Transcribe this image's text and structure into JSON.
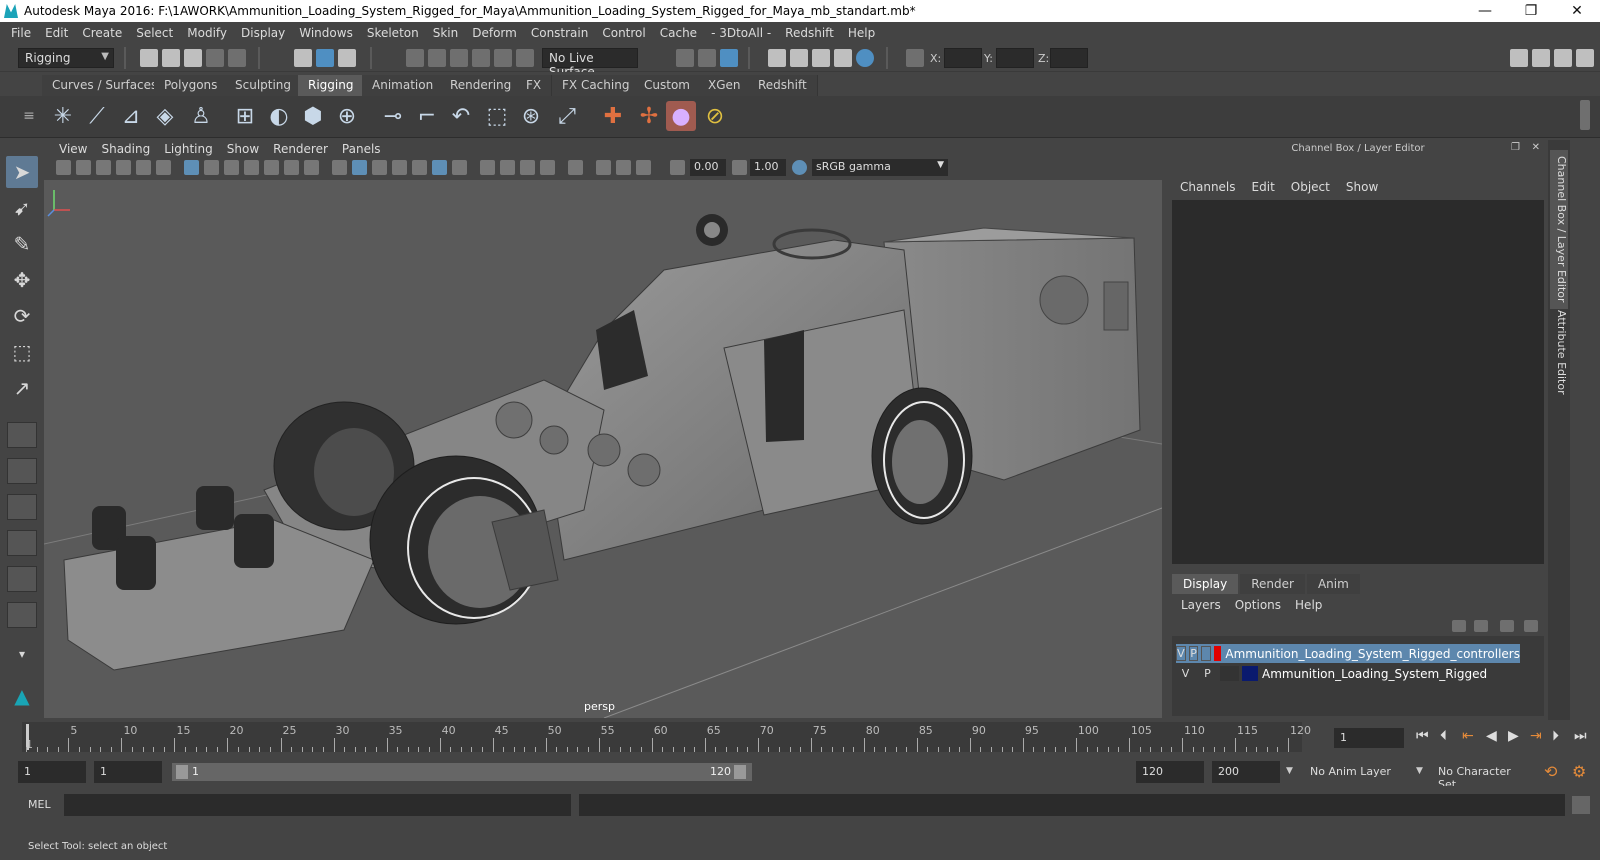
{
  "window": {
    "title": "Autodesk Maya 2016: F:\\1AWORK\\Ammunition_Loading_System_Rigged_for_Maya\\Ammunition_Loading_System_Rigged_for_Maya_mb_standart.mb*",
    "minimize": "—",
    "maximize": "❐",
    "close": "✕"
  },
  "menubar": [
    "File",
    "Edit",
    "Create",
    "Select",
    "Modify",
    "Display",
    "Windows",
    "Skeleton",
    "Skin",
    "Deform",
    "Constrain",
    "Control",
    "Cache",
    "- 3DtoAll -",
    "Redshift",
    "Help"
  ],
  "statusline": {
    "menuset": "Rigging",
    "live_surface": "No Live Surface",
    "x_label": "X:",
    "y_label": "Y:",
    "z_label": "Z:"
  },
  "shelf_tabs": [
    "Curves / Surfaces",
    "Polygons",
    "Sculpting",
    "Rigging",
    "Animation",
    "Rendering",
    "FX",
    "FX Caching",
    "Custom",
    "XGen",
    "Redshift"
  ],
  "shelf_active": "Rigging",
  "viewport": {
    "menu": [
      "View",
      "Shading",
      "Lighting",
      "Show",
      "Renderer",
      "Panels"
    ],
    "exposure": "0.00",
    "gamma": "1.00",
    "color_space": "sRGB gamma",
    "camera": "persp"
  },
  "channel_box": {
    "title": "Channel Box / Layer Editor",
    "menu": [
      "Channels",
      "Edit",
      "Object",
      "Show"
    ]
  },
  "layer_editor": {
    "tabs": [
      "Display",
      "Render",
      "Anim"
    ],
    "active_tab": "Display",
    "menu": [
      "Layers",
      "Options",
      "Help"
    ],
    "layers": [
      {
        "v": "V",
        "p": "P",
        "color": "#e00000",
        "name": "Ammunition_Loading_System_Rigged_controllers",
        "selected": true
      },
      {
        "v": "V",
        "p": "P",
        "color": "#0a1a6e",
        "name": "Ammunition_Loading_System_Rigged",
        "selected": false
      }
    ]
  },
  "side_tabs": [
    "Channel Box / Layer Editor",
    "Attribute Editor"
  ],
  "timeline": {
    "ticks": [
      "5",
      "10",
      "15",
      "20",
      "25",
      "30",
      "35",
      "40",
      "45",
      "50",
      "55",
      "60",
      "65",
      "70",
      "75",
      "80",
      "85",
      "90",
      "95",
      "100",
      "105",
      "110",
      "115",
      "120"
    ],
    "start_marker": "1",
    "current_frame": "1"
  },
  "range": {
    "start": "1",
    "playback_start": "1",
    "slider_start": "1",
    "slider_end": "120",
    "playback_end": "120",
    "end": "200",
    "anim_layer": "No Anim Layer",
    "character_set": "No Character Set"
  },
  "cmdline": {
    "language": "MEL"
  },
  "helpline": "Select Tool: select an object"
}
